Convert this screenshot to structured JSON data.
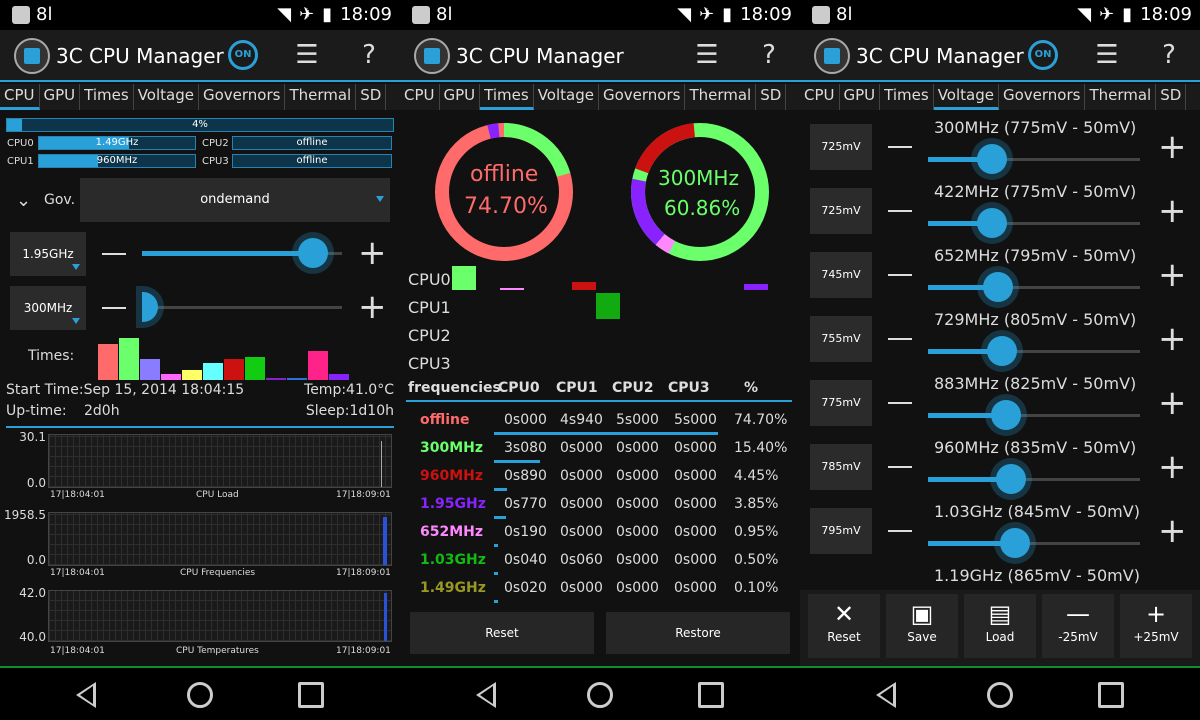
{
  "status": {
    "carrier": "8l",
    "time": "18:09"
  },
  "app": {
    "title": "3C CPU Manager",
    "on_label": "ON",
    "question": "?"
  },
  "tabs": [
    "CPU",
    "GPU",
    "Times",
    "Voltage",
    "Governors",
    "Thermal",
    "SD"
  ],
  "cpu_panel": {
    "total_load": "4%",
    "total_load_fraction": 0.04,
    "cores": [
      {
        "label": "CPU0",
        "value": "1.49GHz",
        "fraction": 0.58
      },
      {
        "label": "CPU2",
        "value": "offline",
        "fraction": 0
      },
      {
        "label": "CPU1",
        "value": "960MHz",
        "fraction": 0.38
      },
      {
        "label": "CPU3",
        "value": "offline",
        "fraction": 0
      }
    ],
    "gov_label": "Gov.",
    "governor": "ondemand",
    "max_freq": "1.95GHz",
    "max_fraction": 0.95,
    "min_freq": "300MHz",
    "min_fraction": 0.0,
    "times_label": "Times:",
    "times_bars": [
      {
        "color": "#ff6b6b",
        "value": 0.78
      },
      {
        "color": "#6bff6b",
        "value": 0.92
      },
      {
        "color": "#8a7cff",
        "value": 0.45
      },
      {
        "color": "#ff66ff",
        "value": 0.12
      },
      {
        "color": "#ffff66",
        "value": 0.22
      },
      {
        "color": "#66ffff",
        "value": 0.38
      },
      {
        "color": "#cc1111",
        "value": 0.45
      },
      {
        "color": "#11cc11",
        "value": 0.5
      },
      {
        "color": "#8822cc",
        "value": 0.04
      },
      {
        "color": "#2a72d8",
        "value": 0.02
      },
      {
        "color": "#ff2288",
        "value": 0.62
      },
      {
        "color": "#8822ff",
        "value": 0.14
      }
    ],
    "start_time": "Start Time:Sep 15, 2014 18:04:15",
    "temp": "Temp:41.0°C",
    "uptime_label": "Up-time:",
    "uptime": "2d0h",
    "sleep": "Sleep:1d10h",
    "graphs": [
      {
        "max": "30.1",
        "min": "0.0",
        "start": "17|18:04:01",
        "end": "17|18:09:01",
        "title": "CPU Load"
      },
      {
        "max": "1958.5",
        "min": "0.0",
        "start": "17|18:04:01",
        "end": "17|18:09:01",
        "title": "CPU Frequencies"
      },
      {
        "max": "42.0",
        "min": "40.0",
        "start": "17|18:04:01",
        "end": "17|18:09:01",
        "title": "CPU Temperatures"
      }
    ]
  },
  "times_panel": {
    "ring1": {
      "label": "offline",
      "percent": "74.70%"
    },
    "ring2": {
      "label": "300MHz",
      "percent": "60.86%"
    },
    "cpu_rows": [
      "CPU0",
      "CPU1",
      "CPU2",
      "CPU3"
    ],
    "headers": [
      "frequencies",
      "CPU0",
      "CPU1",
      "CPU2",
      "CPU3",
      "%"
    ],
    "rows": [
      {
        "freq": "offline",
        "color": "#ff6b6b",
        "c0": "0s000",
        "c1": "4s940",
        "c2": "5s000",
        "c3": "5s000",
        "pct": "74.70%",
        "fraction": 0.747
      },
      {
        "freq": "300MHz",
        "color": "#6bff6b",
        "c0": "3s080",
        "c1": "0s000",
        "c2": "0s000",
        "c3": "0s000",
        "pct": "15.40%",
        "fraction": 0.154
      },
      {
        "freq": "960MHz",
        "color": "#cc1111",
        "c0": "0s890",
        "c1": "0s000",
        "c2": "0s000",
        "c3": "0s000",
        "pct": "4.45%",
        "fraction": 0.0445
      },
      {
        "freq": "1.95GHz",
        "color": "#8822ff",
        "c0": "0s770",
        "c1": "0s000",
        "c2": "0s000",
        "c3": "0s000",
        "pct": "3.85%",
        "fraction": 0.0385
      },
      {
        "freq": "652MHz",
        "color": "#ff88ff",
        "c0": "0s190",
        "c1": "0s000",
        "c2": "0s000",
        "c3": "0s000",
        "pct": "0.95%",
        "fraction": 0.0095
      },
      {
        "freq": "1.03GHz",
        "color": "#11bb11",
        "c0": "0s040",
        "c1": "0s060",
        "c2": "0s000",
        "c3": "0s000",
        "pct": "0.50%",
        "fraction": 0.005
      },
      {
        "freq": "1.49GHz",
        "color": "#999922",
        "c0": "0s020",
        "c1": "0s000",
        "c2": "0s000",
        "c3": "0s000",
        "pct": "0.10%",
        "fraction": 0.001
      }
    ],
    "reset": "Reset",
    "restore": "Restore"
  },
  "voltage_panel": {
    "rows": [
      {
        "mv": "725mV",
        "label": "300MHz (775mV - 50mV)",
        "fraction": 0.3
      },
      {
        "mv": "725mV",
        "label": "422MHz (775mV - 50mV)",
        "fraction": 0.3
      },
      {
        "mv": "745mV",
        "label": "652MHz (795mV - 50mV)",
        "fraction": 0.33
      },
      {
        "mv": "755mV",
        "label": "729MHz (805mV - 50mV)",
        "fraction": 0.35
      },
      {
        "mv": "775mV",
        "label": "883MHz (825mV - 50mV)",
        "fraction": 0.37
      },
      {
        "mv": "785mV",
        "label": "960MHz (835mV - 50mV)",
        "fraction": 0.39
      },
      {
        "mv": "795mV",
        "label": "1.03GHz (845mV - 50mV)",
        "fraction": 0.41
      }
    ],
    "partial_row": "1.19GHz (865mV - 50mV)",
    "buttons": {
      "reset": "Reset",
      "save": "Save",
      "load": "Load",
      "minus": "-25mV",
      "plus": "+25mV"
    }
  }
}
